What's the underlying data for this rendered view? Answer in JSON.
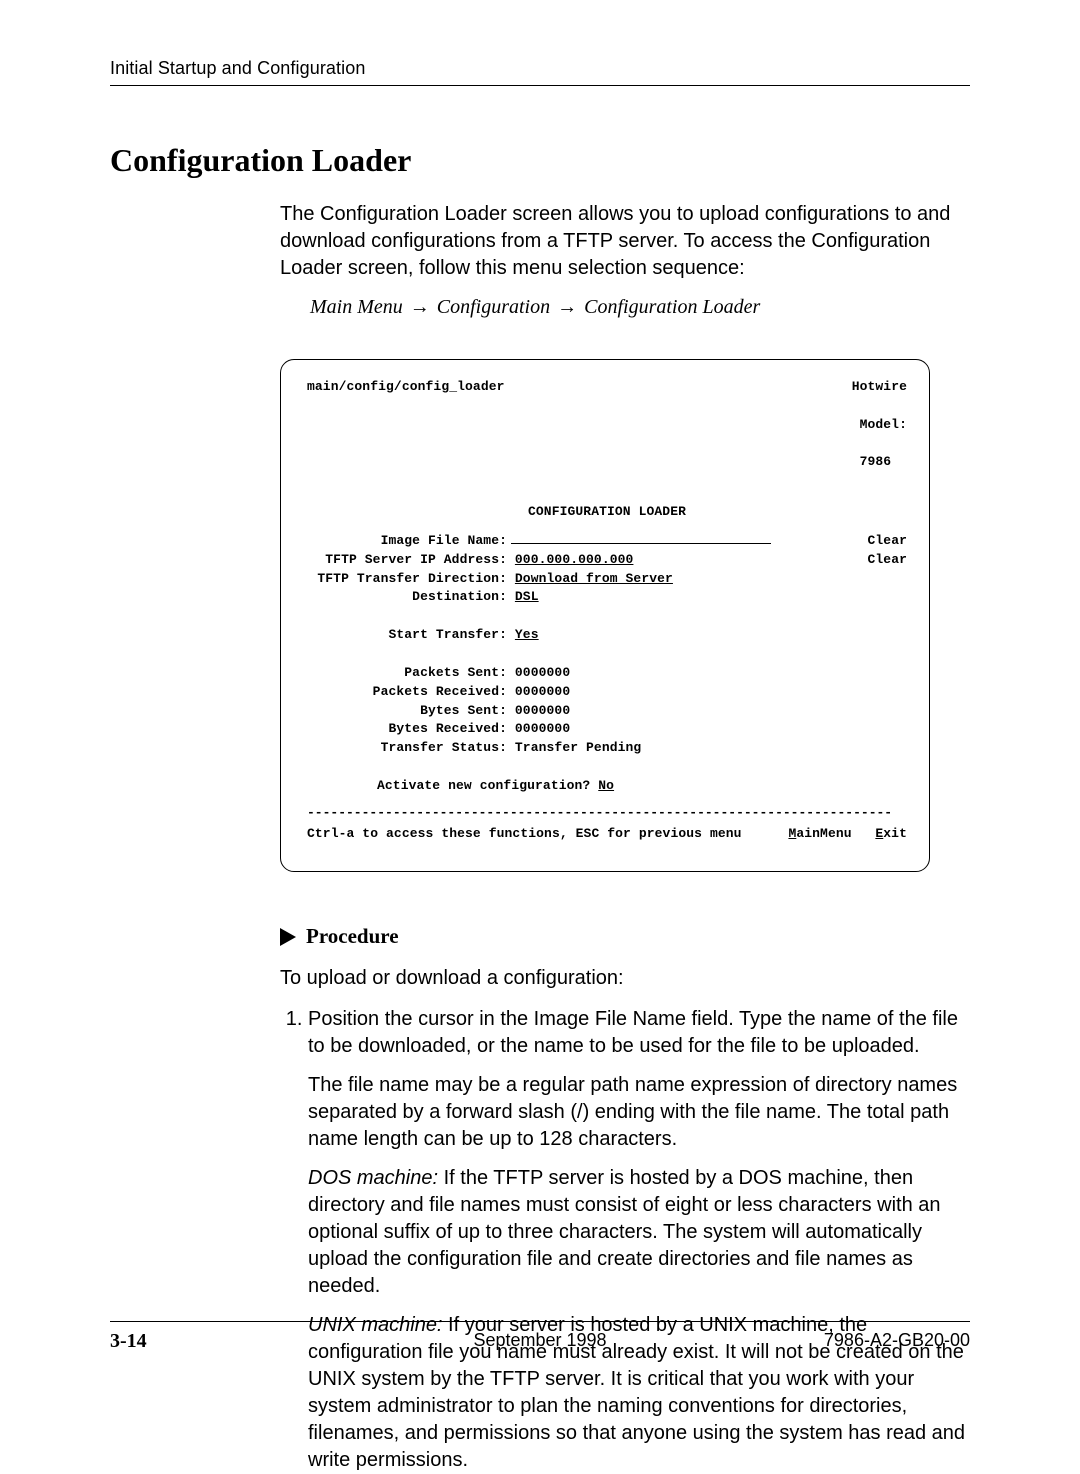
{
  "header": {
    "running_title": "Initial Startup and Configuration"
  },
  "section": {
    "title": "Configuration Loader",
    "intro": "The Configuration Loader screen allows you to upload configurations to and download configurations from a TFTP server. To access the Configuration Loader screen, follow this menu selection sequence:",
    "menu_path": {
      "a": "Main Menu",
      "b": "Configuration",
      "c": "Configuration Loader"
    }
  },
  "terminal": {
    "path": "main/config/config_loader",
    "brand": "Hotwire",
    "model_label": "Model:",
    "model_value": "7986",
    "title": "CONFIGURATION LOADER",
    "fields": {
      "image_file_name_label": "Image File Name:",
      "image_file_name_clear": "Clear",
      "tftp_ip_label": "TFTP Server IP Address:",
      "tftp_ip_value": "000.000.000.000",
      "tftp_ip_clear": "Clear",
      "transfer_dir_label": "TFTP Transfer Direction:",
      "transfer_dir_value": "Download from Server",
      "destination_label": "Destination:",
      "destination_value": "DSL",
      "start_transfer_label": "Start Transfer:",
      "start_transfer_value": "Yes",
      "packets_sent_label": "Packets Sent:",
      "packets_sent_value": "0000000",
      "packets_received_label": "Packets Received:",
      "packets_received_value": "0000000",
      "bytes_sent_label": "Bytes Sent:",
      "bytes_sent_value": "0000000",
      "bytes_received_label": "Bytes Received:",
      "bytes_received_value": "0000000",
      "transfer_status_label": "Transfer Status:",
      "transfer_status_value": "Transfer Pending",
      "activate_label": "Activate new configuration?",
      "activate_value": "No"
    },
    "footer_hint": "Ctrl-a to access these functions, ESC for previous menu",
    "footer_menu_main_u": "M",
    "footer_menu_main_rest": "ainMenu",
    "footer_menu_exit_u": "E",
    "footer_menu_exit_rest": "xit"
  },
  "procedure": {
    "label": "Procedure",
    "intro": "To upload or download a configuration:",
    "step1_p1": "Position the cursor in the Image File Name field. Type the name of the file to be downloaded, or the name to be used for the file to be uploaded.",
    "step1_p2": "The file name may be a regular path name expression of directory names separated by a forward slash (/) ending with the file name. The total path name length can be up to 128 characters.",
    "step1_dos_lead": "DOS machine:",
    "step1_dos_rest": " If the TFTP server is hosted by a DOS machine, then directory and file names must consist of eight or less characters with an optional suffix of up to three characters. The system will automatically upload the configuration file and create directories and file names as needed.",
    "step1_unix_lead": "UNIX machine:",
    "step1_unix_rest": " If your server is hosted by a UNIX machine, the configuration file you name must already exist. It will not be created on the UNIX system by the TFTP server. It is critical that you work with your system administrator to plan the naming conventions for directories, filenames, and permissions so that anyone using the system has read and write permissions."
  },
  "footer": {
    "page": "3-14",
    "date": "September 1998",
    "doc_id": "7986-A2-GB20-00"
  }
}
